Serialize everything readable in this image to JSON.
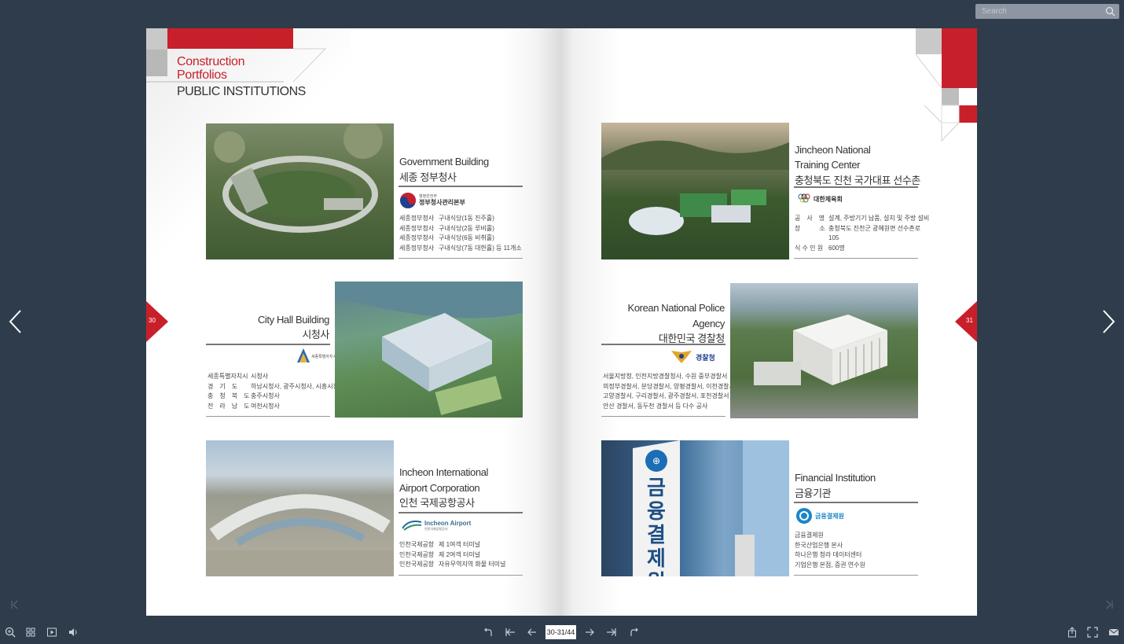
{
  "search": {
    "placeholder": "Search"
  },
  "left_page": {
    "section_title_1": "Construction",
    "section_title_2": "Portfolios",
    "subtitle": "PUBLIC INSTITUTIONS",
    "page_number": "30",
    "projects": [
      {
        "title_en": "Government Building",
        "title_kr": "세종 정부청사",
        "logo_text": "정부청사관리본부",
        "logo_small": "행정안전부",
        "lines": [
          [
            "세종정부청사",
            "구내식당(1동 진주홀)"
          ],
          [
            "세종정부청사",
            "구내식당(2동 루비홀)"
          ],
          [
            "세종정부청사",
            "구내식당(6동 비취홀)"
          ],
          [
            "세종정부청사",
            "구내식당(7동 대한홀) 등 11개소"
          ]
        ]
      },
      {
        "title_en": "City Hall Building",
        "title_kr": "시청사",
        "logo_text": "세종특별자치시",
        "lines": [
          [
            "세종특별자치시",
            "시청사"
          ],
          [
            "경　기　도",
            "하남시청사, 광주시청사, 시흥시청사"
          ],
          [
            "충　청　북　도",
            "충주시청사"
          ],
          [
            "전　라　남　도",
            "여천시청사"
          ]
        ]
      },
      {
        "title_en_1": "Incheon International",
        "title_en_2": "Airport Corporation",
        "title_kr": "인천 국제공항공사",
        "logo_text": "Incheon Airport",
        "logo_small": "인천국제공항공사",
        "lines": [
          [
            "인천국제공항",
            "제 1여객 터미널"
          ],
          [
            "인천국제공항",
            "제 2여객 터미널"
          ],
          [
            "인천국제공항",
            "자유무역지역 화물 터미널"
          ]
        ]
      }
    ]
  },
  "right_page": {
    "page_number": "31",
    "projects": [
      {
        "title_en_1": "Jincheon National",
        "title_en_2": "Training Center",
        "title_kr": "충청북도 진천 국가대표 선수촌",
        "logo_text": "대한체육회",
        "lines": [
          [
            "공　사　명",
            "설계, 주방기기 납품, 설치 및 주방 설비"
          ],
          [
            "장　　　소",
            "충청북도 진천군 광혜원면 선수촌로"
          ],
          [
            "",
            "105"
          ],
          [
            "식 수 인 원",
            "600명"
          ]
        ]
      },
      {
        "title_en_1": "Korean National Police",
        "title_en_2": "Agency",
        "title_kr": "대한민국 경찰청",
        "logo_text": "경찰청",
        "lines": [
          "서울지방청, 인천지방경찰청사, 수원 중부경찰서",
          "의정부경찰서, 분당경찰서, 양평경찰서, 이천경찰서",
          "고양경찰서, 구리경찰서, 광주경찰서, 포천경찰서",
          "안산 경찰서, 동두천 경찰서 등 다수 공사"
        ]
      },
      {
        "title_en": "Financial Institution",
        "title_kr": "금융기관",
        "logo_text": "금융결제원",
        "sign_text": "금융결제원",
        "lines": [
          "금융결제원",
          "한국산업은행 본사",
          "하나은행 청라 데이터센터",
          "기업은행 본점, 증권 연수원"
        ]
      }
    ]
  },
  "toolbar": {
    "page_indicator": "30-31/44"
  },
  "colors": {
    "accent": "#c8202b",
    "background": "#2f3c4b",
    "toolbar_icon": "#c9d0d8"
  }
}
